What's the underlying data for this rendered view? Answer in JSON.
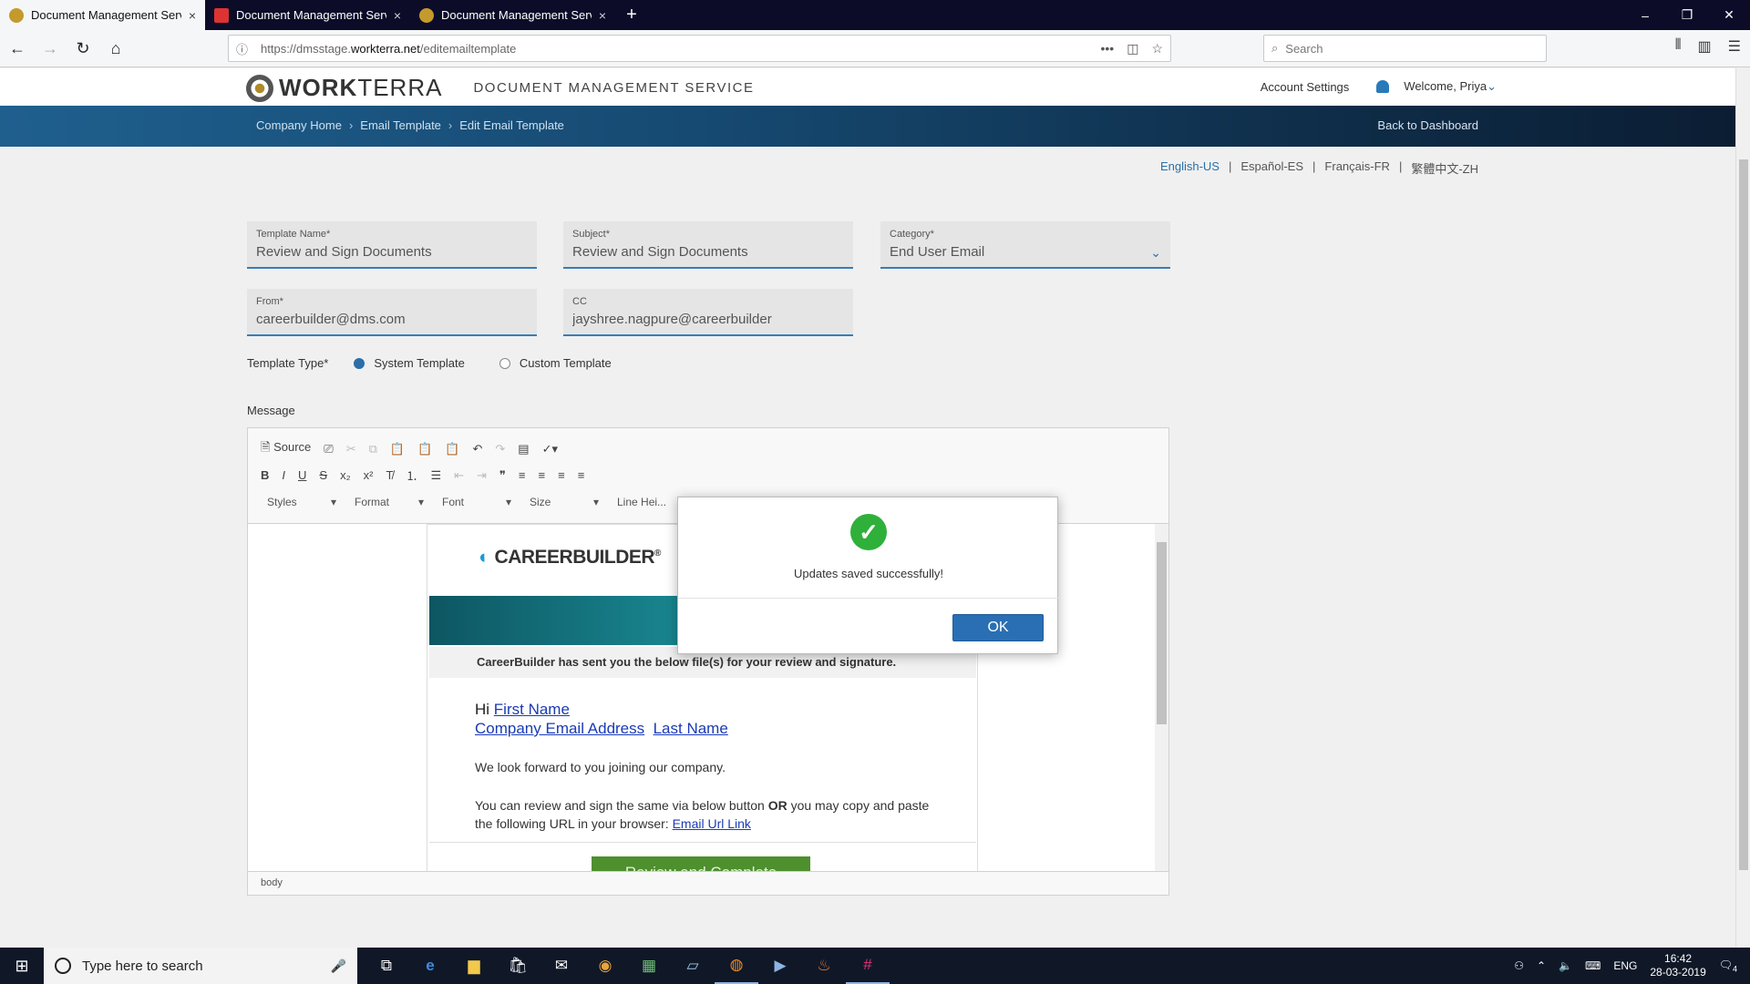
{
  "browser": {
    "tabs": [
      {
        "title": "Document Management Servic",
        "active": true,
        "favicon_color": "#c49a2c"
      },
      {
        "title": "Document Management Servic",
        "active": false,
        "favicon_color": "#dd3333"
      },
      {
        "title": "Document Management Servic",
        "active": false,
        "favicon_color": "#c49a2c"
      }
    ],
    "url_prefix": "https://dmsstage.",
    "url_domain": "workterra.net",
    "url_path": "/editemailtemplate",
    "search_placeholder": "Search",
    "new_tab": "+",
    "close": "×",
    "minimize": "–",
    "restore": "❐",
    "window_close": "✕"
  },
  "app": {
    "brand_strong": "WORK",
    "brand_light": "TERRA",
    "service": "DOCUMENT MANAGEMENT SERVICE",
    "account_settings": "Account Settings",
    "welcome": "Welcome, Priya",
    "breadcrumbs": [
      "Company Home",
      "Email Template",
      "Edit Email Template"
    ],
    "back_to_dashboard": "Back to Dashboard",
    "languages": [
      "English-US",
      "Español-ES",
      "Français-FR",
      "繁體中文-ZH"
    ],
    "separator": "|"
  },
  "form": {
    "template_name": {
      "label": "Template Name*",
      "value": "Review and Sign Documents"
    },
    "subject": {
      "label": "Subject*",
      "value": "Review and Sign Documents"
    },
    "category": {
      "label": "Category*",
      "value": "End User Email"
    },
    "from": {
      "label": "From*",
      "value": "careerbuilder@dms.com"
    },
    "cc": {
      "label": "CC",
      "value": "jayshree.nagpure@careerbuilder"
    },
    "template_type_label": "Template Type*",
    "template_types": [
      {
        "label": "System Template",
        "selected": true
      },
      {
        "label": "Custom Template",
        "selected": false
      }
    ],
    "message_label": "Message"
  },
  "editor": {
    "source_label": "Source",
    "combos": [
      "Styles",
      "Format",
      "Font",
      "Size",
      "Line Hei..."
    ],
    "status_path": "body"
  },
  "email": {
    "logo_text": "CAREERBUILDER",
    "logo_mark": "®",
    "notice": "CareerBuilder has sent you the below file(s) for your review and signature.",
    "greeting": "Hi",
    "first_name": "First Name",
    "company_email": "Company Email Address",
    "last_name": "Last Name",
    "line2": "We look forward to you joining our company.",
    "line3a": "You can review and sign the same via below button",
    "line3_bold": "OR",
    "line3b": "you may copy and paste the following URL in your browser:",
    "email_url_link": "Email Url Link",
    "cta": "Review and Complete"
  },
  "modal": {
    "message": "Updates saved successfully!",
    "ok_label": "OK",
    "success_color": "#2fb03a"
  },
  "taskbar": {
    "search_placeholder": "Type here to search",
    "language": "ENG",
    "time": "16:42",
    "date": "28-03-2019",
    "notifications": "4"
  }
}
